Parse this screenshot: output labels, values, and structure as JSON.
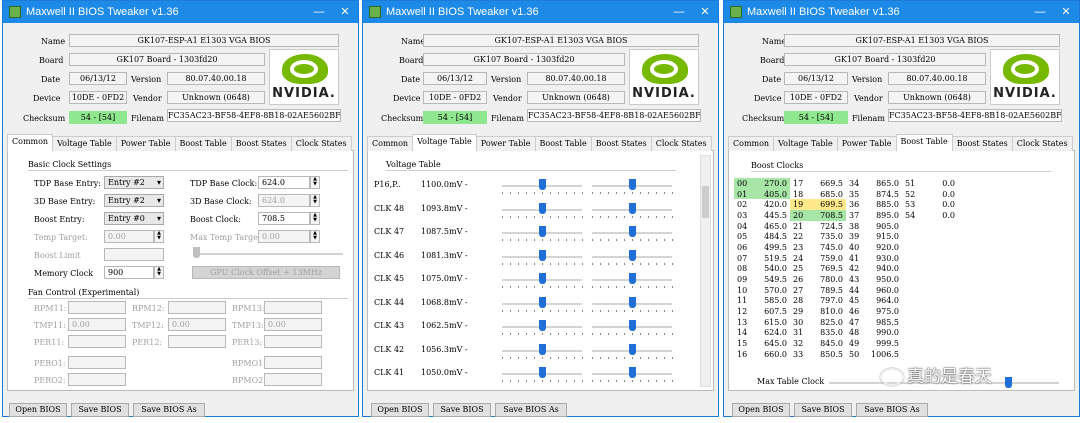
{
  "app_title": "Maxwell II BIOS Tweaker v1.36",
  "window_controls": {
    "minimize": "—",
    "close": "✕"
  },
  "info": {
    "name_label": "Name",
    "name_value": "GK107-ESP-A1 E1303 VGA BIOS",
    "board_label": "Board",
    "board_value": "GK107 Board - 1303fd20",
    "date_label": "Date",
    "date_value": "06/13/12",
    "version_label": "Version",
    "version_value": "80.07.40.00.18",
    "device_label": "Device",
    "device_value": "10DE - 0FD2",
    "vendor_label": "Vendor",
    "vendor_value": "Unknown (0648)",
    "checksum_label": "Checksum",
    "checksum_value": "54 - [54]",
    "filename_label": "Filenam",
    "filename_value": "FC35AC23-BF58-4EF8-8B18-02AE5602BF57_16",
    "logo_text": "NVIDIA."
  },
  "tabs": [
    "Common",
    "Voltage Table",
    "Power Table",
    "Boost Table",
    "Boost States",
    "Clock States"
  ],
  "buttons": {
    "open": "Open BIOS",
    "save": "Save BIOS",
    "save_as": "Save BIOS As"
  },
  "common": {
    "basic_title": "Basic Clock Settings",
    "tdp_entry_label": "TDP Base Entry:",
    "tdp_entry_value": "Entry #2",
    "d3_entry_label": "3D Base Entry:",
    "d3_entry_value": "Entry #2",
    "boost_entry_label": "Boost Entry:",
    "boost_entry_value": "Entry #0",
    "temp_target_label": "Temp Target:",
    "temp_target_value": "0.00",
    "boost_limit_label": "Boost Limit",
    "memory_clock_label": "Memory Clock",
    "memory_clock_value": "900",
    "tdp_clock_label": "TDP Base Clock:",
    "tdp_clock_value": "624.0",
    "d3_clock_label": "3D Base Clock:",
    "d3_clock_value": "624.0",
    "boost_clock_label": "Boost Clock:",
    "boost_clock_value": "708.5",
    "max_temp_label": "Max Temp Target:",
    "max_temp_value": "0.00",
    "gpu_offset_label": "GPU Clock Offset + 13MHz",
    "fan_title": "Fan Control (Experimental)",
    "fan_row1": [
      "RPM11:",
      "RPM12:",
      "RPM13:"
    ],
    "fan_row2": [
      "TMP11:",
      "TMP12:",
      "TMP13:"
    ],
    "fan_row2_values": [
      "0.00",
      "0.00",
      "0.00"
    ],
    "fan_row3": [
      "PER11:",
      "PER12:",
      "PER13:"
    ],
    "fan_row4": [
      "PERO1:",
      "RPMO1:"
    ],
    "fan_row5": [
      "PERO2:",
      "RPMO2:"
    ]
  },
  "voltage": {
    "title": "Voltage Table",
    "rows": [
      {
        "name": "P16,P..",
        "value": "1100.0mV -",
        "level1": 0.5,
        "level2": 0.5
      },
      {
        "name": "CLK 48",
        "value": "1093.8mV -",
        "level1": 0.5,
        "level2": 0.5
      },
      {
        "name": "CLK 47",
        "value": "1087.5mV -",
        "level1": 0.5,
        "level2": 0.5
      },
      {
        "name": "CLK 46",
        "value": "1081.3mV -",
        "level1": 0.5,
        "level2": 0.5
      },
      {
        "name": "CLK 45",
        "value": "1075.0mV -",
        "level1": 0.5,
        "level2": 0.5
      },
      {
        "name": "CLK 44",
        "value": "1068.8mV -",
        "level1": 0.5,
        "level2": 0.5
      },
      {
        "name": "CLK 43",
        "value": "1062.5mV -",
        "level1": 0.5,
        "level2": 0.5
      },
      {
        "name": "CLK 42",
        "value": "1056.3mV -",
        "level1": 0.5,
        "level2": 0.5
      },
      {
        "name": "CLK 41",
        "value": "1050.0mV -",
        "level1": 0.5,
        "level2": 0.5
      }
    ]
  },
  "boost": {
    "title": "Boost Clocks",
    "rows": [
      [
        [
          "00",
          "270.0"
        ],
        [
          "17",
          "669.5"
        ],
        [
          "34",
          "865.0"
        ],
        [
          "51",
          "0.0"
        ]
      ],
      [
        [
          "01",
          "405.0"
        ],
        [
          "18",
          "685.0"
        ],
        [
          "35",
          "874.5"
        ],
        [
          "52",
          "0.0"
        ]
      ],
      [
        [
          "02",
          "420.0"
        ],
        [
          "19",
          "699.5"
        ],
        [
          "36",
          "885.0"
        ],
        [
          "53",
          "0.0"
        ]
      ],
      [
        [
          "03",
          "445.5"
        ],
        [
          "20",
          "708.5"
        ],
        [
          "37",
          "895.0"
        ],
        [
          "54",
          "0.0"
        ]
      ],
      [
        [
          "04",
          "465.0"
        ],
        [
          "21",
          "724.5"
        ],
        [
          "38",
          "905.0"
        ],
        [
          "",
          ""
        ]
      ],
      [
        [
          "05",
          "484.5"
        ],
        [
          "22",
          "735.0"
        ],
        [
          "39",
          "915.0"
        ],
        [
          "",
          ""
        ]
      ],
      [
        [
          "06",
          "499.5"
        ],
        [
          "23",
          "745.0"
        ],
        [
          "40",
          "920.0"
        ],
        [
          "",
          ""
        ]
      ],
      [
        [
          "07",
          "519.5"
        ],
        [
          "24",
          "759.0"
        ],
        [
          "41",
          "930.0"
        ],
        [
          "",
          ""
        ]
      ],
      [
        [
          "08",
          "540.0"
        ],
        [
          "25",
          "769.5"
        ],
        [
          "42",
          "940.0"
        ],
        [
          "",
          ""
        ]
      ],
      [
        [
          "09",
          "549.5"
        ],
        [
          "26",
          "780.0"
        ],
        [
          "43",
          "950.0"
        ],
        [
          "",
          ""
        ]
      ],
      [
        [
          "10",
          "570.0"
        ],
        [
          "27",
          "789.5"
        ],
        [
          "44",
          "960.0"
        ],
        [
          "",
          ""
        ]
      ],
      [
        [
          "11",
          "585.0"
        ],
        [
          "28",
          "797.0"
        ],
        [
          "45",
          "964.0"
        ],
        [
          "",
          ""
        ]
      ],
      [
        [
          "12",
          "607.5"
        ],
        [
          "29",
          "810.0"
        ],
        [
          "46",
          "975.0"
        ],
        [
          "",
          ""
        ]
      ],
      [
        [
          "13",
          "615.0"
        ],
        [
          "30",
          "825.0"
        ],
        [
          "47",
          "985.5"
        ],
        [
          "",
          ""
        ]
      ],
      [
        [
          "14",
          "624.0"
        ],
        [
          "31",
          "835.0"
        ],
        [
          "48",
          "990.0"
        ],
        [
          "",
          ""
        ]
      ],
      [
        [
          "15",
          "645.0"
        ],
        [
          "32",
          "845.0"
        ],
        [
          "49",
          "999.5"
        ],
        [
          "",
          ""
        ]
      ],
      [
        [
          "16",
          "660.0"
        ],
        [
          "33",
          "850.5"
        ],
        [
          "50",
          "1006.5"
        ],
        [
          "",
          ""
        ]
      ]
    ],
    "max_table_clock_label": "Max Table Clock"
  },
  "watermark": "真的是春天",
  "colors": {
    "titlebar": "#1c8ae6",
    "checksum_ok": "#8fe88f",
    "highlight_green": "#a8e6a8",
    "highlight_yellow": "#ffe98a",
    "slider": "#1f6fd6"
  }
}
